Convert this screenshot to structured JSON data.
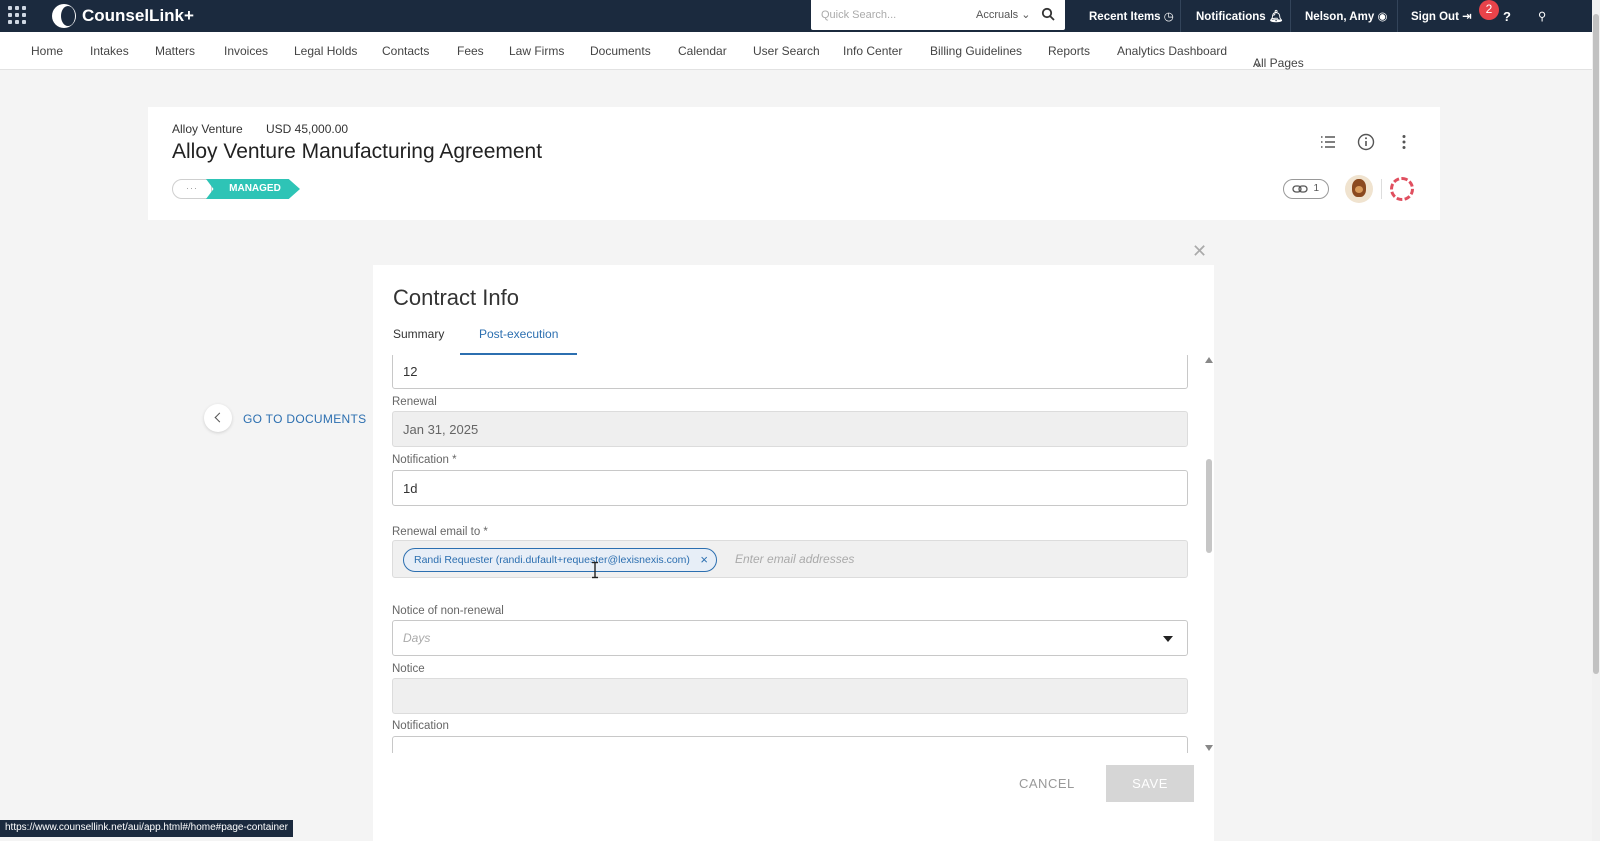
{
  "app": {
    "name": "CounselLink+",
    "search_placeholder": "Quick Search...",
    "search_scope": "Accruals",
    "recent_items": "Recent Items",
    "notifications": "Notifications",
    "user_name": "Nelson, Amy",
    "sign_out": "Sign Out",
    "badge_count": "2"
  },
  "nav": {
    "items": [
      "Home",
      "Intakes",
      "Matters",
      "Invoices",
      "Legal Holds",
      "Contacts",
      "Fees",
      "Law Firms",
      "Documents",
      "Calendar",
      "User Search",
      "Info Center",
      "Billing Guidelines",
      "Reports",
      "Analytics Dashboard",
      "All Pages"
    ]
  },
  "matter": {
    "client": "Alloy Venture",
    "amount": "USD 45,000.00",
    "title": "Alloy Venture Manufacturing Agreement",
    "status_dots": "···",
    "status": "MANAGED",
    "link_count": "1"
  },
  "goto_documents": "GO TO DOCUMENTS",
  "modal": {
    "title": "Contract Info",
    "tabs": [
      {
        "label": "Summary"
      },
      {
        "label": "Post-execution"
      }
    ],
    "active_tab": "Post-execution",
    "fields": {
      "term_value": "12",
      "renewal_label": "Renewal",
      "renewal_value": "Jan 31, 2025",
      "notification_label": "Notification *",
      "notification_value": "1d",
      "renewal_email_label": "Renewal email to *",
      "email_chip": "Randi Requester (randi.dufault+requester@lexisnexis.com)",
      "email_placeholder": "Enter email addresses",
      "notice_nonrenewal_label": "Notice of non-renewal",
      "notice_nonrenewal_placeholder": "Days",
      "notice_label": "Notice",
      "notice_value": "",
      "notification2_label": "Notification"
    },
    "cancel": "CANCEL",
    "save": "SAVE"
  },
  "status_bar_url": "https://www.counsellink.net/aui/app.html#/home#page-container",
  "colors": {
    "topbar": "#1b2a3e",
    "accent": "#2c6fb0",
    "managed": "#2ec4b6",
    "badge": "#e8434a"
  }
}
